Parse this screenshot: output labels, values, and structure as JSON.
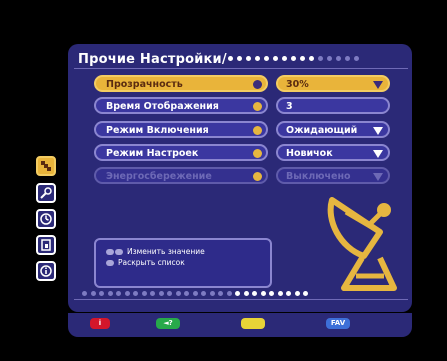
{
  "title": "Прочие Настройки/",
  "rows": [
    {
      "label": "Прозрачность",
      "value": "30%",
      "state": "active",
      "dropdown": true
    },
    {
      "label": "Время Отображения",
      "value": "3",
      "state": "normal",
      "dropdown": false
    },
    {
      "label": "Режим Включения",
      "value": "Ожидающий",
      "state": "normal",
      "dropdown": true
    },
    {
      "label": "Режим Настроек",
      "value": "Новичок",
      "state": "normal",
      "dropdown": true
    },
    {
      "label": "Энергосбережение",
      "value": "Выключено",
      "state": "disabled",
      "dropdown": true
    }
  ],
  "help": {
    "line1": "Изменить значение",
    "line2": "Раскрыть список"
  },
  "side_icons": [
    "satellite-icon",
    "wrench-icon",
    "clock-icon",
    "door-icon",
    "info-icon"
  ],
  "keys": {
    "red": "i",
    "green": "◄?",
    "yellow": "",
    "blue": "FAV"
  },
  "colors": {
    "panel": "#2b2977",
    "accent": "#e9b43a",
    "border": "#8b86d0"
  }
}
